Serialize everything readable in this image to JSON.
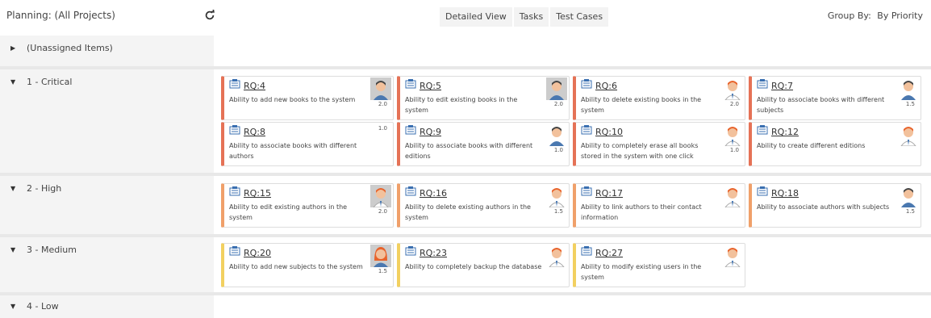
{
  "header": {
    "planning_title": "Planning: (All Projects)",
    "tabs": [
      "Detailed View",
      "Tasks",
      "Test Cases"
    ],
    "group_by_label": "Group By:",
    "group_by_value": "By Priority"
  },
  "rows": [
    {
      "label": "(Unassigned Items)",
      "expanded": false
    },
    {
      "label": "1 - Critical",
      "expanded": true
    },
    {
      "label": "2 - High",
      "expanded": true
    },
    {
      "label": "3 - Medium",
      "expanded": true
    },
    {
      "label": "4 - Low",
      "expanded": true
    }
  ],
  "cards": {
    "critical": [
      {
        "id": "RQ:4",
        "desc": "Ability to add new books to the system",
        "estimate": "2.0",
        "avatar": "male-dark-hair"
      },
      {
        "id": "RQ:5",
        "desc": "Ability to edit existing books in the system",
        "estimate": "2.0",
        "avatar": "male-dark-hair"
      },
      {
        "id": "RQ:6",
        "desc": "Ability to delete existing books in the system",
        "estimate": "2.0",
        "avatar": "male-red-hair"
      },
      {
        "id": "RQ:7",
        "desc": "Ability to associate books with different subjects",
        "estimate": "1.5",
        "avatar": "male-dark-hair"
      },
      {
        "id": "RQ:8",
        "desc": "Ability to associate books with different authors",
        "estimate": "1.0",
        "avatar": ""
      },
      {
        "id": "RQ:9",
        "desc": "Ability to associate books with different editions",
        "estimate": "1.0",
        "avatar": "male-dark-hair"
      },
      {
        "id": "RQ:10",
        "desc": "Ability to completely erase all books stored in the system with one click",
        "estimate": "1.0",
        "avatar": "male-red-hair"
      },
      {
        "id": "RQ:12",
        "desc": "Ability to create different editions",
        "estimate": "",
        "avatar": "male-red-hair"
      }
    ],
    "high": [
      {
        "id": "RQ:15",
        "desc": "Ability to edit existing authors in the system",
        "estimate": "2.0",
        "avatar": "male-red-hair"
      },
      {
        "id": "RQ:16",
        "desc": "Ability to delete existing authors in the system",
        "estimate": "1.5",
        "avatar": "male-red-hair"
      },
      {
        "id": "RQ:17",
        "desc": "Ability to link authors to their contact information",
        "estimate": "",
        "avatar": "male-red-hair"
      },
      {
        "id": "RQ:18",
        "desc": "Ability to associate authors with subjects",
        "estimate": "1.5",
        "avatar": "male-dark-hair"
      }
    ],
    "medium": [
      {
        "id": "RQ:20",
        "desc": "Ability to add new subjects to the system",
        "estimate": "1.5",
        "avatar": "female-red-hair"
      },
      {
        "id": "RQ:23",
        "desc": "Ability to completely backup the database",
        "estimate": "",
        "avatar": "male-red-hair"
      },
      {
        "id": "RQ:27",
        "desc": "Ability to modify existing users in the system",
        "estimate": "",
        "avatar": "male-red-hair"
      }
    ]
  },
  "colors": {
    "critical": "#e57256",
    "high": "#f0a06a",
    "medium": "#f2d060"
  }
}
